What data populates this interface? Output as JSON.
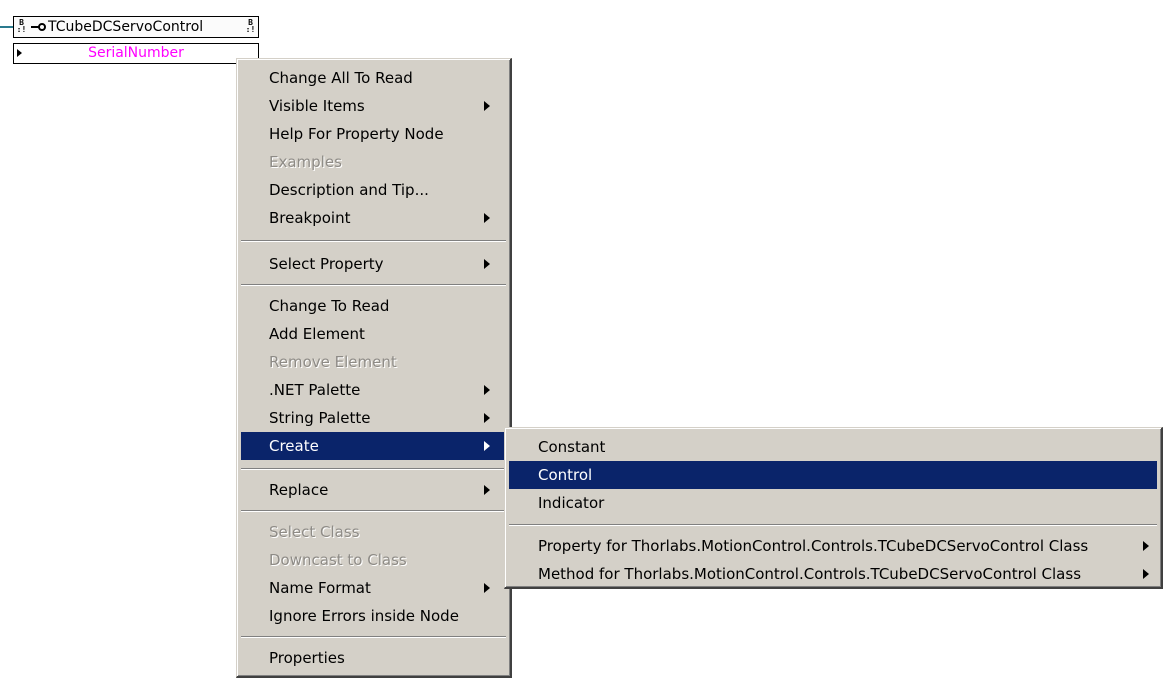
{
  "node": {
    "title": "TCubeDCServoControl",
    "property": "SerialNumber"
  },
  "context_menu": {
    "items": [
      {
        "label": "Change All To Read",
        "enabled": true,
        "submenu": false
      },
      {
        "label": "Visible Items",
        "enabled": true,
        "submenu": true
      },
      {
        "label": "Help For Property Node",
        "enabled": true,
        "submenu": false
      },
      {
        "label": "Examples",
        "enabled": false,
        "submenu": false
      },
      {
        "label": "Description and Tip...",
        "enabled": true,
        "submenu": false
      },
      {
        "label": "Breakpoint",
        "enabled": true,
        "submenu": true
      },
      {
        "label": "Select Property",
        "enabled": true,
        "submenu": true
      },
      {
        "label": "Change To Read",
        "enabled": true,
        "submenu": false
      },
      {
        "label": "Add Element",
        "enabled": true,
        "submenu": false
      },
      {
        "label": "Remove Element",
        "enabled": false,
        "submenu": false
      },
      {
        "label": ".NET Palette",
        "enabled": true,
        "submenu": true
      },
      {
        "label": "String Palette",
        "enabled": true,
        "submenu": true
      },
      {
        "label": "Create",
        "enabled": true,
        "submenu": true,
        "selected": true
      },
      {
        "label": "Replace",
        "enabled": true,
        "submenu": true
      },
      {
        "label": "Select Class",
        "enabled": false,
        "submenu": false
      },
      {
        "label": "Downcast to Class",
        "enabled": false,
        "submenu": false
      },
      {
        "label": "Name Format",
        "enabled": true,
        "submenu": true
      },
      {
        "label": "Ignore Errors inside Node",
        "enabled": true,
        "submenu": false
      },
      {
        "label": "Properties",
        "enabled": true,
        "submenu": false
      }
    ]
  },
  "create_submenu": {
    "items": [
      {
        "label": "Constant",
        "enabled": true,
        "submenu": false
      },
      {
        "label": "Control",
        "enabled": true,
        "submenu": false,
        "selected": true
      },
      {
        "label": "Indicator",
        "enabled": true,
        "submenu": false
      },
      {
        "label": "Property for Thorlabs.MotionControl.Controls.TCubeDCServoControl Class",
        "enabled": true,
        "submenu": true
      },
      {
        "label": "Method for Thorlabs.MotionControl.Controls.TCubeDCServoControl Class",
        "enabled": true,
        "submenu": true
      }
    ]
  },
  "colors": {
    "menu_bg": "#d4d0c8",
    "highlight": "#0a246a",
    "property_text": "#ff00ff",
    "wire": "#2a7a8e"
  }
}
